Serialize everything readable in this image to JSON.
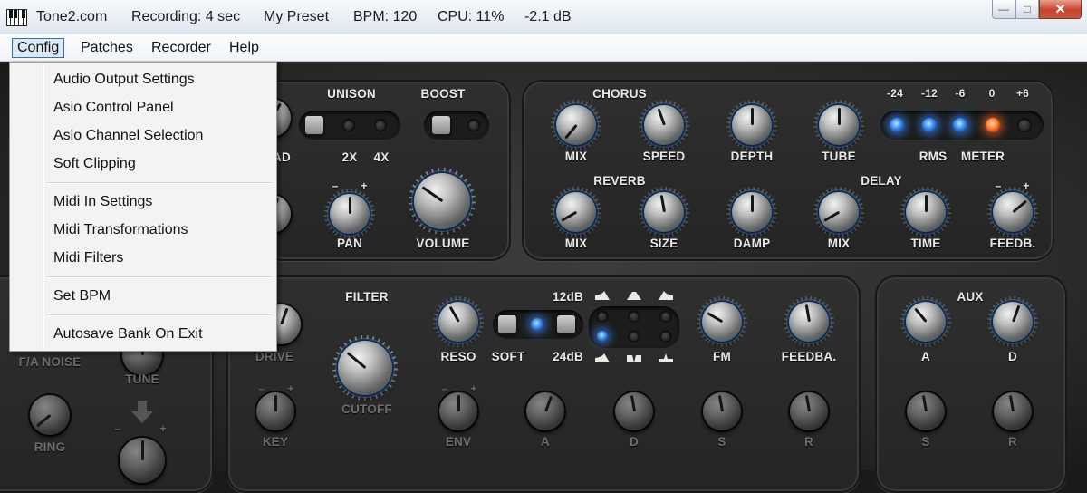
{
  "titlebar": {
    "app_name": "Tone2.com",
    "recording": "Recording: 4 sec",
    "preset": "My Preset",
    "bpm": "BPM: 120",
    "cpu": "CPU: 11%",
    "level": "-2.1 dB",
    "minimize": "—",
    "maximize": "□",
    "close": "✕"
  },
  "menubar": {
    "items": [
      "Config",
      "Patches",
      "Recorder",
      "Help"
    ]
  },
  "config_menu": {
    "items": [
      "Audio Output Settings",
      "Asio Control Panel",
      "Asio Channel Selection",
      "Soft Clipping",
      "Midi In Settings",
      "Midi Transformations",
      "Midi Filters",
      "Set BPM",
      "Autosave Bank On Exit"
    ]
  },
  "synth": {
    "unison": {
      "title": "UNISON",
      "label_2x": "2X",
      "label_4x": "4X",
      "spread_fragment": "AD"
    },
    "boost": {
      "title": "BOOST"
    },
    "pan": {
      "label": "PAN",
      "minus": "–",
      "plus": "+"
    },
    "volume": {
      "label": "VOLUME"
    },
    "chorus": {
      "title": "CHORUS",
      "mix": "MIX",
      "speed": "SPEED",
      "depth": "DEPTH"
    },
    "tube": {
      "label": "TUBE"
    },
    "meter": {
      "ticks": [
        "-24",
        "-12",
        "-6",
        "0",
        "+6"
      ],
      "rms": "RMS",
      "meter": "METER",
      "lit_count": 4
    },
    "reverb": {
      "title": "REVERB",
      "mix": "MIX",
      "size": "SIZE",
      "damp": "DAMP"
    },
    "delay": {
      "title": "DELAY",
      "mix": "MIX",
      "time": "TIME",
      "feedb": "FEEDB.",
      "minus": "–",
      "plus": "+"
    },
    "filter": {
      "title": "FILTER",
      "drive": "DRIVE",
      "cutoff": "CUTOFF",
      "reso": "RESO",
      "soft": "SOFT",
      "db12": "12dB",
      "db24": "24dB",
      "key": "KEY",
      "env": "ENV",
      "fm": "FM",
      "feedba": "FEEDBA.",
      "env_a": "A",
      "env_d": "D",
      "env_s": "S",
      "env_r": "R"
    },
    "aux": {
      "title": "AUX",
      "a": "A",
      "d": "D",
      "s": "S",
      "r": "R"
    },
    "osc": {
      "fa_noise": "F/A NOISE",
      "tune": "TUNE",
      "ring": "RING"
    }
  },
  "colors": {
    "led_blue": "#3f8ff5",
    "led_orange": "#ff7a2c",
    "close_button": "#c7422b"
  }
}
